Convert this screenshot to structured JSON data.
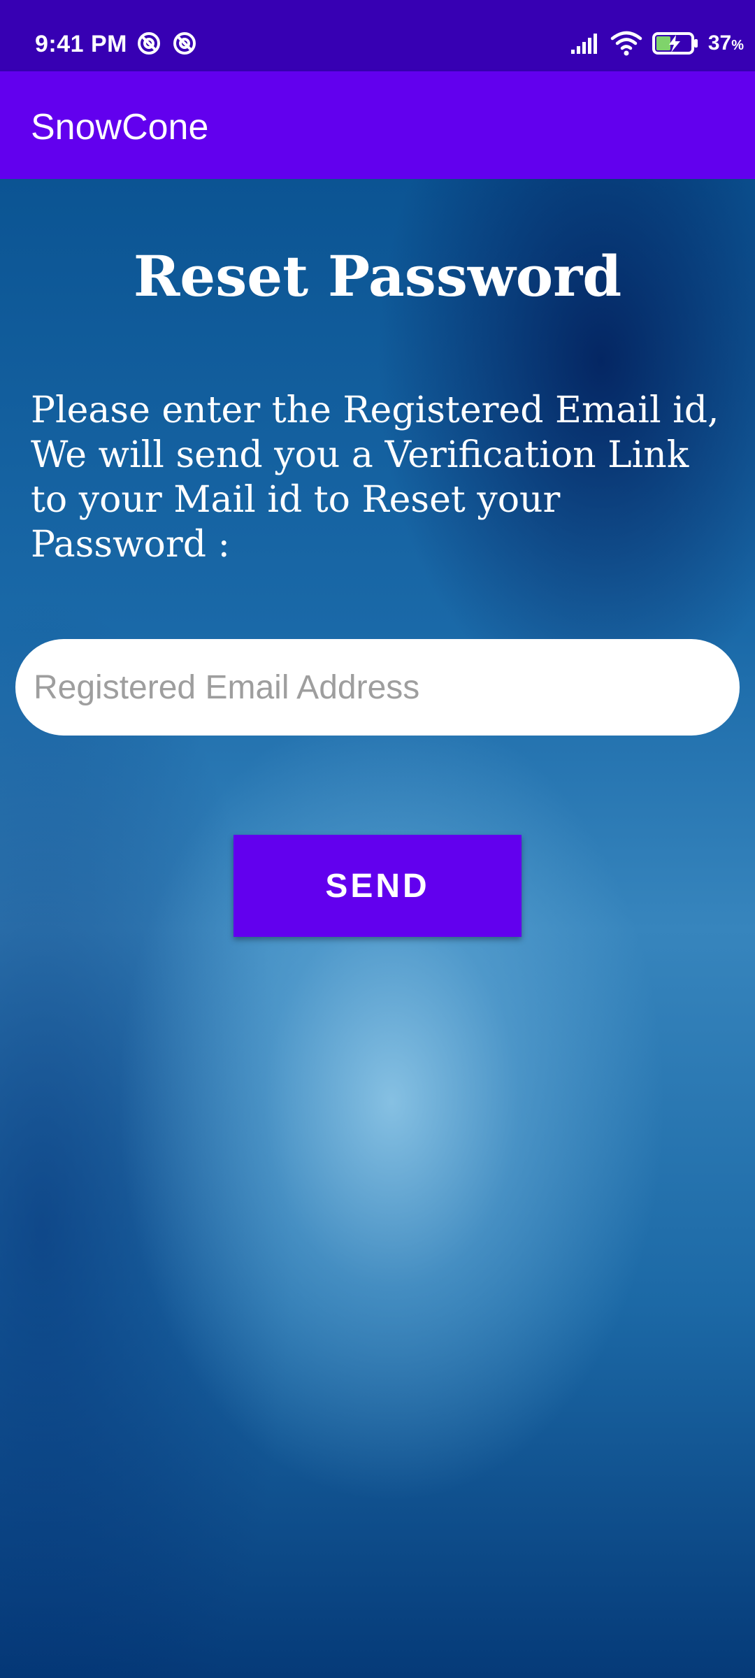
{
  "status_bar": {
    "time": "9:41 PM",
    "battery_percent": "37",
    "battery_unit": "%",
    "icons": [
      "app-notification-icon",
      "app-notification-icon",
      "signal-icon",
      "wifi-icon",
      "battery-charging-icon"
    ]
  },
  "app_bar": {
    "title": "SnowCone"
  },
  "main": {
    "heading": "Reset Password",
    "instructions": "Please enter the Registered Email id, We will send you a Verification Link to your Mail id to Reset your Password :",
    "email_field": {
      "value": "",
      "placeholder": "Registered Email Address"
    },
    "send_button_label": "SEND"
  },
  "colors": {
    "status_bar": "#3700b3",
    "app_bar": "#6200ee",
    "button": "#6200ee",
    "input_bg": "#ffffff",
    "placeholder": "#9e9e9e"
  }
}
